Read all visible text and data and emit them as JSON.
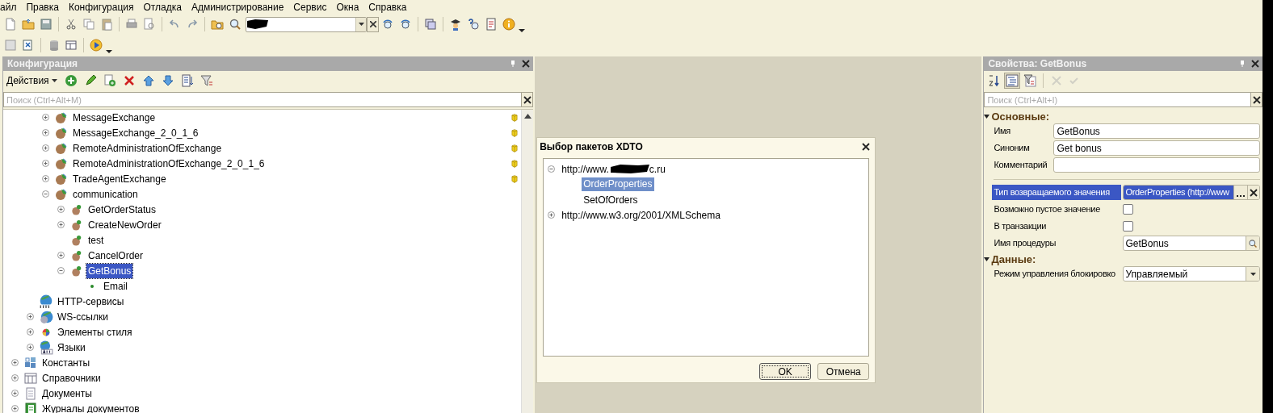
{
  "menu": [
    "айл",
    "Правка",
    "Конфигурация",
    "Отладка",
    "Администрирование",
    "Сервис",
    "Окна",
    "Справка"
  ],
  "config_panel": {
    "title": "Конфигурация",
    "actions_label": "Действия",
    "search": {
      "placeholder": "Поиск (Ctrl+Alt+M)"
    },
    "tree": [
      {
        "children": [
          {
            "children": [
              {
                "label": "MessageExchange",
                "kind": "ws",
                "expanded": false,
                "selected": false,
                "locked": true
              },
              {
                "label": "MessageExchange_2_0_1_6",
                "kind": "ws",
                "expanded": false,
                "selected": false,
                "locked": true
              },
              {
                "label": "RemoteAdministrationOfExchange",
                "kind": "ws",
                "expanded": false,
                "selected": false,
                "locked": true
              },
              {
                "label": "RemoteAdministrationOfExchange_2_0_1_6",
                "kind": "ws",
                "expanded": false,
                "selected": false,
                "locked": true
              },
              {
                "label": "TradeAgentExchange",
                "kind": "ws",
                "expanded": false,
                "selected": false,
                "locked": true
              },
              {
                "label": "communication",
                "kind": "ws",
                "expanded": true,
                "selected": false,
                "locked": false,
                "children": [
                  {
                    "label": "GetOrderStatus",
                    "kind": "operation",
                    "expanded": false,
                    "selected": false
                  },
                  {
                    "label": "CreateNewOrder",
                    "kind": "operation",
                    "expanded": false,
                    "selected": false
                  },
                  {
                    "label": "test",
                    "kind": "operation",
                    "selected": false
                  },
                  {
                    "label": "CancelOrder",
                    "kind": "operation",
                    "expanded": false,
                    "selected": false
                  },
                  {
                    "label": "GetBonus",
                    "kind": "operation",
                    "expanded": true,
                    "selected": true,
                    "children": [
                      {
                        "label": "Email",
                        "kind": "parameter",
                        "selected": false
                      }
                    ]
                  }
                ]
              }
            ]
          },
          {
            "label": "HTTP-сервисы",
            "kind": "http",
            "selected": false
          },
          {
            "label": "WS-ссылки",
            "kind": "wslink",
            "expanded": false,
            "selected": false
          },
          {
            "label": "Элементы стиля",
            "kind": "style",
            "expanded": false,
            "selected": false
          },
          {
            "label": "Языки",
            "kind": "language",
            "expanded": false,
            "selected": false
          }
        ]
      },
      {
        "label": "Константы",
        "kind": "constants",
        "expanded": false,
        "selected": false
      },
      {
        "label": "Справочники",
        "kind": "catalogs",
        "expanded": false,
        "selected": false
      },
      {
        "label": "Документы",
        "kind": "documents",
        "expanded": false,
        "selected": false
      },
      {
        "label": "Журналы документов",
        "kind": "journals",
        "expanded": false,
        "selected": false
      }
    ]
  },
  "dialog": {
    "title": "Выбор пакетов XDTO",
    "tree": [
      {
        "label": "http://www.",
        "label_end": "c.ru",
        "expanded": true,
        "selected": false,
        "children": [
          {
            "label": "OrderProperties",
            "selected": true
          },
          {
            "label": "SetOfOrders",
            "selected": false
          }
        ]
      },
      {
        "label": "http://www.w3.org/2001/XMLSchema",
        "expanded": false,
        "selected": false
      }
    ],
    "buttons": [
      {
        "label": "OK",
        "default": true
      },
      {
        "label": "Отмена",
        "default": false
      }
    ]
  },
  "properties_panel": {
    "title": "Свойства: GetBonus",
    "search": {
      "placeholder": "Поиск (Ctrl+Alt+I)"
    },
    "toolbar": [
      {
        "kind": "sort",
        "pressed": false,
        "disabled": false
      },
      {
        "kind": "categories",
        "pressed": true,
        "disabled": false
      },
      {
        "kind": "filter",
        "pressed": false,
        "disabled": false
      },
      {
        "kind": "clear",
        "pressed": false,
        "disabled": true
      },
      {
        "kind": "apply",
        "pressed": false,
        "disabled": true
      }
    ],
    "groups": [
      {
        "title": "Основные:",
        "expanded": true,
        "rows": [
          {
            "kind": "text",
            "label": "Имя",
            "value": "GetBonus",
            "selected": false
          },
          {
            "kind": "text",
            "label": "Синоним",
            "value": "Get bonus",
            "selected": false
          },
          {
            "kind": "text",
            "label": "Комментарий",
            "selected": false
          },
          {
            "kind": "separator"
          },
          {
            "kind": "choice",
            "label": "Тип возвращаемого значения",
            "value": "OrderProperties (http://www",
            "selected": true
          },
          {
            "kind": "checkbox",
            "label": "Возможно пустое значение",
            "checked": false,
            "selected": false
          },
          {
            "kind": "checkbox",
            "label": "В транзакции",
            "checked": false,
            "selected": false
          },
          {
            "kind": "search",
            "label": "Имя процедуры",
            "value": "GetBonus",
            "selected": false
          }
        ]
      },
      {
        "title": "Данные:",
        "expanded": true,
        "rows": [
          {
            "kind": "dropdown",
            "label": "Режим управления блокировко",
            "value": "Управляемый",
            "selected": false
          }
        ]
      }
    ]
  }
}
